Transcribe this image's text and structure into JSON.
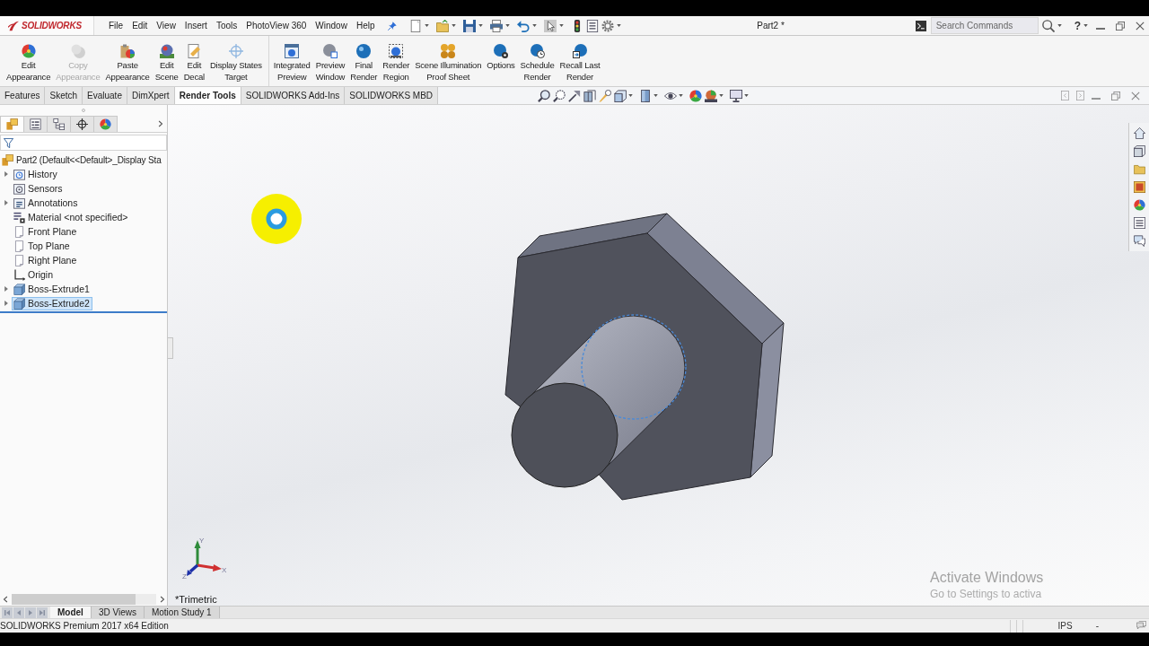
{
  "title_bar": {
    "logo": "SOLIDWORKS",
    "menu": [
      "File",
      "Edit",
      "View",
      "Insert",
      "Tools",
      "PhotoView 360",
      "Window",
      "Help"
    ],
    "document_title": "Part2 *",
    "search": {
      "placeholder": "Search Commands"
    },
    "help": "?"
  },
  "command_manager": {
    "groups": [
      {
        "buttons": [
          {
            "kind": "edit-appearance",
            "lines": [
              "Edit",
              "Appearance"
            ],
            "disabled": false
          },
          {
            "kind": "copy-appearance",
            "lines": [
              "Copy",
              "Appearance"
            ],
            "disabled": true
          },
          {
            "kind": "paste-appearance",
            "lines": [
              "Paste",
              "Appearance"
            ],
            "disabled": false
          },
          {
            "kind": "edit-scene",
            "lines": [
              "Edit",
              "Scene"
            ],
            "disabled": false
          },
          {
            "kind": "edit-decal",
            "lines": [
              "Edit",
              "Decal"
            ],
            "disabled": false
          },
          {
            "kind": "display-states-target",
            "lines": [
              "Display States",
              "Target"
            ],
            "disabled": false
          }
        ]
      },
      {
        "buttons": [
          {
            "kind": "integrated-preview",
            "lines": [
              "Integrated",
              "Preview"
            ],
            "disabled": false
          },
          {
            "kind": "preview-window",
            "lines": [
              "Preview",
              "Window"
            ],
            "disabled": false
          },
          {
            "kind": "final-render",
            "lines": [
              "Final",
              "Render"
            ],
            "disabled": false
          },
          {
            "kind": "render-region",
            "lines": [
              "Render",
              "Region"
            ],
            "disabled": false
          },
          {
            "kind": "scene-illumination-proof-sheet",
            "lines": [
              "Scene Illumination",
              "Proof Sheet"
            ],
            "disabled": false
          },
          {
            "kind": "options",
            "lines": [
              "Options"
            ],
            "disabled": false
          },
          {
            "kind": "schedule-render",
            "lines": [
              "Schedule",
              "Render"
            ],
            "disabled": false
          },
          {
            "kind": "recall-last-render",
            "lines": [
              "Recall Last",
              "Render"
            ],
            "disabled": false
          }
        ]
      }
    ]
  },
  "tabs": [
    {
      "label": "Features",
      "selected": false
    },
    {
      "label": "Sketch",
      "selected": false
    },
    {
      "label": "Evaluate",
      "selected": false
    },
    {
      "label": "DimXpert",
      "selected": false
    },
    {
      "label": "Render Tools",
      "selected": true
    },
    {
      "label": "SOLIDWORKS Add-Ins",
      "selected": false
    },
    {
      "label": "SOLIDWORKS MBD",
      "selected": false
    }
  ],
  "feature_manager": {
    "panel_tabs": [
      {
        "kind": "feature-manager",
        "selected": true
      },
      {
        "kind": "property-manager",
        "selected": false
      },
      {
        "kind": "configuration-manager",
        "selected": false
      },
      {
        "kind": "dimxpert-manager",
        "selected": false
      },
      {
        "kind": "display-manager",
        "selected": false
      }
    ],
    "tree": {
      "label": "Part2 (Default<<Default>_Display Sta",
      "children": [
        {
          "label": "History",
          "kind": "history",
          "expandable": true,
          "selected": false
        },
        {
          "label": "Sensors",
          "kind": "sensors",
          "expandable": false,
          "selected": false
        },
        {
          "label": "Annotations",
          "kind": "annotations",
          "expandable": true,
          "selected": false
        },
        {
          "label": "Material <not specified>",
          "kind": "material",
          "expandable": false,
          "selected": false
        },
        {
          "label": "Front Plane",
          "kind": "plane",
          "expandable": false,
          "selected": false
        },
        {
          "label": "Top Plane",
          "kind": "plane",
          "expandable": false,
          "selected": false
        },
        {
          "label": "Right Plane",
          "kind": "plane",
          "expandable": false,
          "selected": false
        },
        {
          "label": "Origin",
          "kind": "origin",
          "expandable": false,
          "selected": false
        },
        {
          "label": "Boss-Extrude1",
          "kind": "feature",
          "expandable": true,
          "selected": false
        },
        {
          "label": "Boss-Extrude2",
          "kind": "feature",
          "expandable": true,
          "selected": true
        }
      ]
    }
  },
  "viewport": {
    "view_name": "*Trimetric",
    "triad": {
      "x": "X",
      "y": "Y",
      "z": "Z"
    },
    "activation_notice": {
      "title": "Activate Windows",
      "message": "Go to Settings to activa"
    }
  },
  "bottom_tabs": [
    {
      "label": "Model",
      "selected": true
    },
    {
      "label": "3D Views",
      "selected": false
    },
    {
      "label": "Motion Study 1",
      "selected": false
    }
  ],
  "status_bar": {
    "edition": "SOLIDWORKS Premium 2017 x64 Edition",
    "units": "IPS",
    "field_2": "-"
  }
}
